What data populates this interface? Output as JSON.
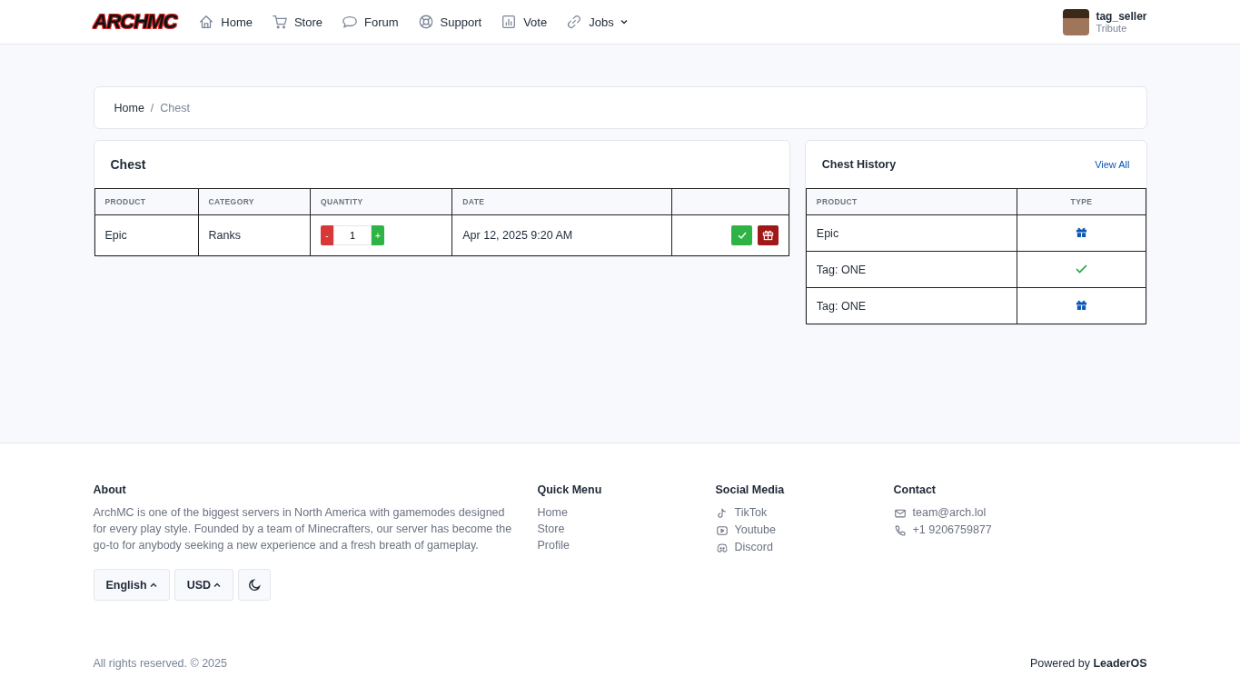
{
  "header": {
    "logo": "ARCHMC",
    "nav": [
      {
        "label": "Home",
        "kind": "home",
        "dropdown": false
      },
      {
        "label": "Store",
        "kind": "cart",
        "dropdown": false
      },
      {
        "label": "Forum",
        "kind": "chat",
        "dropdown": false
      },
      {
        "label": "Support",
        "kind": "lifebuoy",
        "dropdown": false
      },
      {
        "label": "Vote",
        "kind": "chart",
        "dropdown": false
      },
      {
        "label": "Jobs",
        "kind": "link",
        "dropdown": true
      }
    ],
    "user": {
      "name": "tag_seller",
      "rank": "Tribute"
    }
  },
  "breadcrumb": {
    "items": [
      "Home",
      "Chest"
    ],
    "separator": "/"
  },
  "chest": {
    "title": "Chest",
    "columns": [
      "PRODUCT",
      "CATEGORY",
      "QUANTITY",
      "DATE"
    ],
    "rows": [
      {
        "product": "Epic",
        "category": "Ranks",
        "minus": "-",
        "quantity": "1",
        "plus": "+",
        "date": "Apr 12, 2025 9:20 AM"
      }
    ]
  },
  "history": {
    "title": "Chest History",
    "view_all": "View All",
    "columns": [
      "PRODUCT",
      "TYPE"
    ],
    "rows": [
      {
        "product": "Epic",
        "kind": "gift"
      },
      {
        "product": "Tag: ONE",
        "kind": "check"
      },
      {
        "product": "Tag: ONE",
        "kind": "gift"
      }
    ]
  },
  "footer": {
    "about": {
      "title": "About",
      "text": "ArchMC is one of the biggest servers in North America with gamemodes designed for every play style. Founded by a team of Minecrafters, our server has become the go-to for anybody seeking a new experience and a fresh breath of gameplay."
    },
    "language": "English",
    "currency": "USD",
    "quick_menu": {
      "title": "Quick Menu",
      "links": [
        "Home",
        "Store",
        "Profile"
      ]
    },
    "social": {
      "title": "Social Media",
      "links": [
        {
          "label": "TikTok",
          "kind": "tiktok"
        },
        {
          "label": "Youtube",
          "kind": "youtube"
        },
        {
          "label": "Discord",
          "kind": "discord"
        }
      ]
    },
    "contact": {
      "title": "Contact",
      "items": [
        {
          "label": "team@arch.lol",
          "kind": "mail"
        },
        {
          "label": "+1 9206759877",
          "kind": "phone"
        }
      ]
    },
    "copyright": "All rights reserved. © 2025",
    "powered_prefix": "Powered by",
    "powered_brand": "LeaderOS"
  }
}
